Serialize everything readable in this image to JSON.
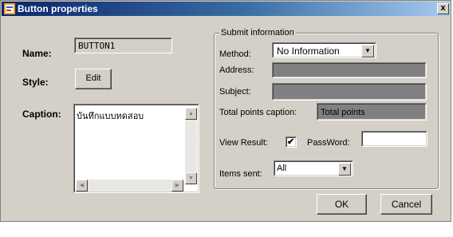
{
  "window": {
    "title": "Button properties",
    "close_label": "x"
  },
  "left": {
    "name_label": "Name:",
    "name_value": "BUTTON1",
    "style_label": "Style:",
    "edit_label": "Edit",
    "caption_label": "Caption:",
    "caption_value": "บันทึกแบบทดสอบ"
  },
  "submit": {
    "group_title": "Submit information",
    "method_label": "Method:",
    "method_value": "No Information",
    "address_label": "Address:",
    "address_value": "",
    "subject_label": "Subject:",
    "subject_value": "",
    "total_points_caption_label": "Total points caption:",
    "total_points_caption_value": "Total points",
    "view_result_label": "View Result:",
    "view_result_checked": true,
    "view_result_mark": "✔",
    "password_label": "PassWord:",
    "password_value": "",
    "items_sent_label": "Items sent:",
    "items_sent_value": "All"
  },
  "footer": {
    "ok_label": "OK",
    "cancel_label": "Cancel"
  },
  "colors": {
    "titlebar_start": "#0a246a",
    "titlebar_end": "#a6caf0",
    "face": "#d4d0c8",
    "disabled_field": "#808080"
  },
  "icons": {
    "app": "properties-window-icon",
    "dropdown": "triangle-down",
    "scroll_up": "triangle-up",
    "scroll_down": "triangle-down",
    "scroll_left": "triangle-left",
    "scroll_right": "triangle-right"
  }
}
